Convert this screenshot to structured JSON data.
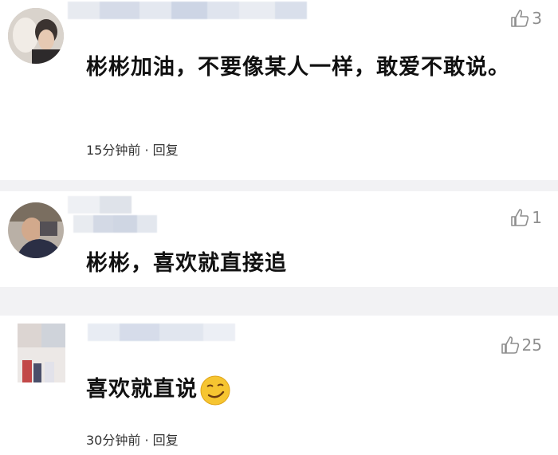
{
  "comments": [
    {
      "likes": "3",
      "text": "彬彬加油，不要像某人一样，敢爱不敢说。",
      "time": "15分钟前 · 回复"
    },
    {
      "likes": "1",
      "text": "彬彬，喜欢就直接追",
      "time": ""
    },
    {
      "likes": "25",
      "text": "喜欢就直说",
      "time": "30分钟前 · 回复"
    }
  ],
  "icons": {
    "like": "thumbs-up-icon",
    "emoji": "smirk-face-emoji"
  },
  "colors": {
    "page_bg": "#f2f2f4",
    "card_bg": "#ffffff",
    "like_gray": "#8e8e8e",
    "emoji_yellow": "#f6c531"
  }
}
